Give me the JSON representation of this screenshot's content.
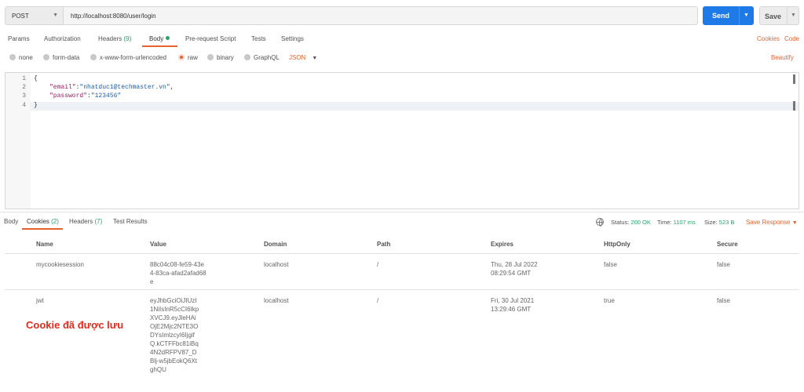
{
  "request": {
    "method": "POST",
    "url": "http://localhost:8080/user/login",
    "send_label": "Send",
    "save_label": "Save"
  },
  "request_tabs": [
    {
      "label": "Params"
    },
    {
      "label": "Authorization"
    },
    {
      "label": "Headers",
      "count": "(9)"
    },
    {
      "label": "Body"
    },
    {
      "label": "Pre-request Script"
    },
    {
      "label": "Tests"
    },
    {
      "label": "Settings"
    }
  ],
  "links": {
    "cookies": "Cookies",
    "code": "Code",
    "beautify": "Beautify"
  },
  "body_types": [
    "none",
    "form-data",
    "x-www-form-urlencoded",
    "raw",
    "binary",
    "GraphQL"
  ],
  "body_type_selected": "raw",
  "format": "JSON",
  "editor": {
    "line_numbers": [
      "1",
      "2",
      "3",
      "4"
    ],
    "open_brace": "{",
    "close_brace": "}",
    "email_key": "\"email\"",
    "email_value": "\"nhatduc1@techmaster.vn\"",
    "password_key": "\"password\"",
    "password_value": "\"123456\""
  },
  "response_tabs": [
    {
      "label": "Body"
    },
    {
      "label": "Cookies",
      "count": "(2)"
    },
    {
      "label": "Headers",
      "count": "(7)"
    },
    {
      "label": "Test Results"
    }
  ],
  "status": {
    "status_label": "Status:",
    "status_value": "200 OK",
    "time_label": "Time:",
    "time_value": "1107 ms",
    "size_label": "Size:",
    "size_value": "523 B",
    "save_response": "Save Response"
  },
  "cookies_table": {
    "headers": [
      "Name",
      "Value",
      "Domain",
      "Path",
      "Expires",
      "HttpOnly",
      "Secure"
    ],
    "rows": [
      {
        "name": "mycookiesession",
        "value": "88c04c08-fe59-43e4-83ca-afad2afad68e",
        "domain": "localhost",
        "path": "/",
        "expires_date": "Thu, 28 Jul 2022",
        "expires_time": "08:29:54 GMT",
        "httponly": "false",
        "secure": "false"
      },
      {
        "name": "jwt",
        "value": "eyJhbGciOiJIUzI1NiIsInR5cCI6IkpXVCJ9.eyJleHAiOjE2Mjc2NTE3ODYsImlzcyI6IjgifQ.kCTFFbc81iBq4N2dRFPV87_DBlj-w5jbEokQ6XtghQU",
        "domain": "localhost",
        "path": "/",
        "expires_date": "Fri, 30 Jul 2021",
        "expires_time": "13:29:46 GMT",
        "httponly": "true",
        "secure": "false"
      }
    ]
  },
  "annotation": "Cookie đã được lưu"
}
